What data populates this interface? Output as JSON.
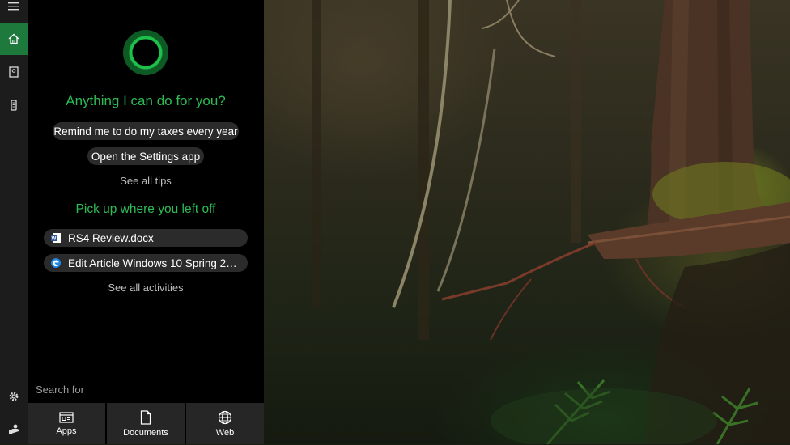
{
  "rail": {
    "items": [
      {
        "icon": "hamburger-menu-icon"
      },
      {
        "icon": "home-icon",
        "active": true
      },
      {
        "icon": "notebook-icon"
      },
      {
        "icon": "devices-icon"
      },
      {
        "icon": "gear-icon"
      },
      {
        "icon": "feedback-icon"
      }
    ]
  },
  "cortana": {
    "greeting": "Anything I can do for you?",
    "tips": [
      {
        "label": "Remind me to do my taxes every year"
      },
      {
        "label": "Open the Settings app"
      }
    ],
    "see_all_tips": "See all tips",
    "pickup_heading": "Pick up where you left off",
    "activities": [
      {
        "label": "RS4 Review.docx",
        "icon": "word-doc-icon"
      },
      {
        "label": "Edit Article Windows 10 Spring 201...",
        "icon": "edge-browser-icon"
      }
    ],
    "see_all_activities": "See all activities"
  },
  "search": {
    "label": "Search for",
    "scopes": [
      {
        "label": "Apps",
        "icon": "apps-icon"
      },
      {
        "label": "Documents",
        "icon": "document-icon"
      },
      {
        "label": "Web",
        "icon": "globe-icon"
      }
    ]
  },
  "colors": {
    "accent": "#1e7a3c",
    "heading_green": "#2dbb55",
    "panel_bg": "#000000",
    "chip_bg": "#2b2b2b"
  }
}
